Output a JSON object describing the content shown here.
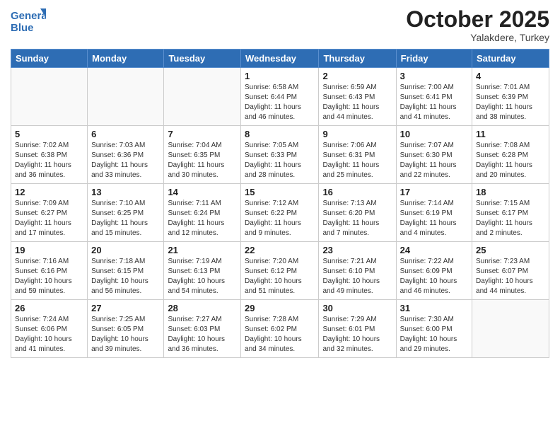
{
  "header": {
    "logo_line1": "General",
    "logo_line2": "Blue",
    "month_title": "October 2025",
    "subtitle": "Yalakdere, Turkey"
  },
  "days_of_week": [
    "Sunday",
    "Monday",
    "Tuesday",
    "Wednesday",
    "Thursday",
    "Friday",
    "Saturday"
  ],
  "weeks": [
    [
      {
        "num": "",
        "info": ""
      },
      {
        "num": "",
        "info": ""
      },
      {
        "num": "",
        "info": ""
      },
      {
        "num": "1",
        "info": "Sunrise: 6:58 AM\nSunset: 6:44 PM\nDaylight: 11 hours\nand 46 minutes."
      },
      {
        "num": "2",
        "info": "Sunrise: 6:59 AM\nSunset: 6:43 PM\nDaylight: 11 hours\nand 44 minutes."
      },
      {
        "num": "3",
        "info": "Sunrise: 7:00 AM\nSunset: 6:41 PM\nDaylight: 11 hours\nand 41 minutes."
      },
      {
        "num": "4",
        "info": "Sunrise: 7:01 AM\nSunset: 6:39 PM\nDaylight: 11 hours\nand 38 minutes."
      }
    ],
    [
      {
        "num": "5",
        "info": "Sunrise: 7:02 AM\nSunset: 6:38 PM\nDaylight: 11 hours\nand 36 minutes."
      },
      {
        "num": "6",
        "info": "Sunrise: 7:03 AM\nSunset: 6:36 PM\nDaylight: 11 hours\nand 33 minutes."
      },
      {
        "num": "7",
        "info": "Sunrise: 7:04 AM\nSunset: 6:35 PM\nDaylight: 11 hours\nand 30 minutes."
      },
      {
        "num": "8",
        "info": "Sunrise: 7:05 AM\nSunset: 6:33 PM\nDaylight: 11 hours\nand 28 minutes."
      },
      {
        "num": "9",
        "info": "Sunrise: 7:06 AM\nSunset: 6:31 PM\nDaylight: 11 hours\nand 25 minutes."
      },
      {
        "num": "10",
        "info": "Sunrise: 7:07 AM\nSunset: 6:30 PM\nDaylight: 11 hours\nand 22 minutes."
      },
      {
        "num": "11",
        "info": "Sunrise: 7:08 AM\nSunset: 6:28 PM\nDaylight: 11 hours\nand 20 minutes."
      }
    ],
    [
      {
        "num": "12",
        "info": "Sunrise: 7:09 AM\nSunset: 6:27 PM\nDaylight: 11 hours\nand 17 minutes."
      },
      {
        "num": "13",
        "info": "Sunrise: 7:10 AM\nSunset: 6:25 PM\nDaylight: 11 hours\nand 15 minutes."
      },
      {
        "num": "14",
        "info": "Sunrise: 7:11 AM\nSunset: 6:24 PM\nDaylight: 11 hours\nand 12 minutes."
      },
      {
        "num": "15",
        "info": "Sunrise: 7:12 AM\nSunset: 6:22 PM\nDaylight: 11 hours\nand 9 minutes."
      },
      {
        "num": "16",
        "info": "Sunrise: 7:13 AM\nSunset: 6:20 PM\nDaylight: 11 hours\nand 7 minutes."
      },
      {
        "num": "17",
        "info": "Sunrise: 7:14 AM\nSunset: 6:19 PM\nDaylight: 11 hours\nand 4 minutes."
      },
      {
        "num": "18",
        "info": "Sunrise: 7:15 AM\nSunset: 6:17 PM\nDaylight: 11 hours\nand 2 minutes."
      }
    ],
    [
      {
        "num": "19",
        "info": "Sunrise: 7:16 AM\nSunset: 6:16 PM\nDaylight: 10 hours\nand 59 minutes."
      },
      {
        "num": "20",
        "info": "Sunrise: 7:18 AM\nSunset: 6:15 PM\nDaylight: 10 hours\nand 56 minutes."
      },
      {
        "num": "21",
        "info": "Sunrise: 7:19 AM\nSunset: 6:13 PM\nDaylight: 10 hours\nand 54 minutes."
      },
      {
        "num": "22",
        "info": "Sunrise: 7:20 AM\nSunset: 6:12 PM\nDaylight: 10 hours\nand 51 minutes."
      },
      {
        "num": "23",
        "info": "Sunrise: 7:21 AM\nSunset: 6:10 PM\nDaylight: 10 hours\nand 49 minutes."
      },
      {
        "num": "24",
        "info": "Sunrise: 7:22 AM\nSunset: 6:09 PM\nDaylight: 10 hours\nand 46 minutes."
      },
      {
        "num": "25",
        "info": "Sunrise: 7:23 AM\nSunset: 6:07 PM\nDaylight: 10 hours\nand 44 minutes."
      }
    ],
    [
      {
        "num": "26",
        "info": "Sunrise: 7:24 AM\nSunset: 6:06 PM\nDaylight: 10 hours\nand 41 minutes."
      },
      {
        "num": "27",
        "info": "Sunrise: 7:25 AM\nSunset: 6:05 PM\nDaylight: 10 hours\nand 39 minutes."
      },
      {
        "num": "28",
        "info": "Sunrise: 7:27 AM\nSunset: 6:03 PM\nDaylight: 10 hours\nand 36 minutes."
      },
      {
        "num": "29",
        "info": "Sunrise: 7:28 AM\nSunset: 6:02 PM\nDaylight: 10 hours\nand 34 minutes."
      },
      {
        "num": "30",
        "info": "Sunrise: 7:29 AM\nSunset: 6:01 PM\nDaylight: 10 hours\nand 32 minutes."
      },
      {
        "num": "31",
        "info": "Sunrise: 7:30 AM\nSunset: 6:00 PM\nDaylight: 10 hours\nand 29 minutes."
      },
      {
        "num": "",
        "info": ""
      }
    ]
  ]
}
